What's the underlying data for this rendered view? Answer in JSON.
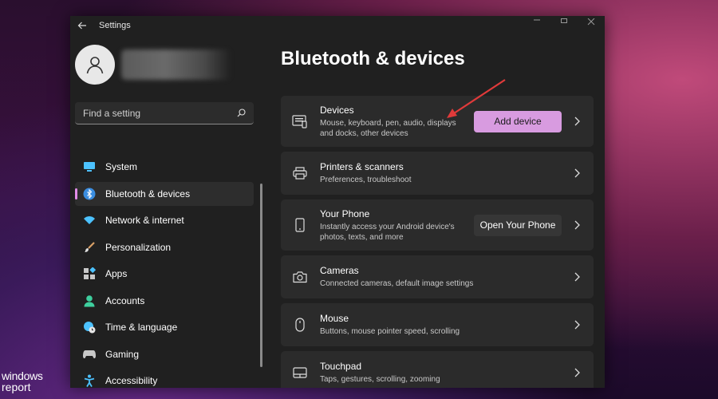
{
  "window": {
    "title": "Settings"
  },
  "search": {
    "placeholder": "Find a setting"
  },
  "sidebar": {
    "items": [
      {
        "label": "System",
        "icon": "display-icon",
        "selected": false
      },
      {
        "label": "Bluetooth & devices",
        "icon": "bluetooth-icon",
        "selected": true
      },
      {
        "label": "Network & internet",
        "icon": "wifi-icon",
        "selected": false
      },
      {
        "label": "Personalization",
        "icon": "brush-icon",
        "selected": false
      },
      {
        "label": "Apps",
        "icon": "apps-icon",
        "selected": false
      },
      {
        "label": "Accounts",
        "icon": "person-icon",
        "selected": false
      },
      {
        "label": "Time & language",
        "icon": "globe-clock-icon",
        "selected": false
      },
      {
        "label": "Gaming",
        "icon": "gamepad-icon",
        "selected": false
      },
      {
        "label": "Accessibility",
        "icon": "accessibility-icon",
        "selected": false
      }
    ]
  },
  "main": {
    "title": "Bluetooth & devices",
    "cards": [
      {
        "title": "Devices",
        "desc_line1": "Mouse, keyboard, pen, audio, displays",
        "desc_line2": "and docks, other devices",
        "button": "Add device",
        "icon": "devices-icon"
      },
      {
        "title": "Printers & scanners",
        "desc_line1": "Preferences, troubleshoot",
        "icon": "printer-icon"
      },
      {
        "title": "Your Phone",
        "desc_line1": "Instantly access your Android device's",
        "desc_line2": "photos, texts, and more",
        "button": "Open Your Phone",
        "icon": "phone-icon"
      },
      {
        "title": "Cameras",
        "desc_line1": "Connected cameras, default image settings",
        "icon": "camera-icon"
      },
      {
        "title": "Mouse",
        "desc_line1": "Buttons, mouse pointer speed, scrolling",
        "icon": "mouse-icon"
      },
      {
        "title": "Touchpad",
        "desc_line1": "Taps, gestures, scrolling, zooming",
        "icon": "touchpad-icon"
      }
    ]
  },
  "watermark": {
    "line1": "windows",
    "line2": "report"
  },
  "colors": {
    "accent": "#d89be0",
    "window_bg": "#202020",
    "card_bg": "#2b2b2b",
    "annotation_arrow": "#e03a3a"
  }
}
